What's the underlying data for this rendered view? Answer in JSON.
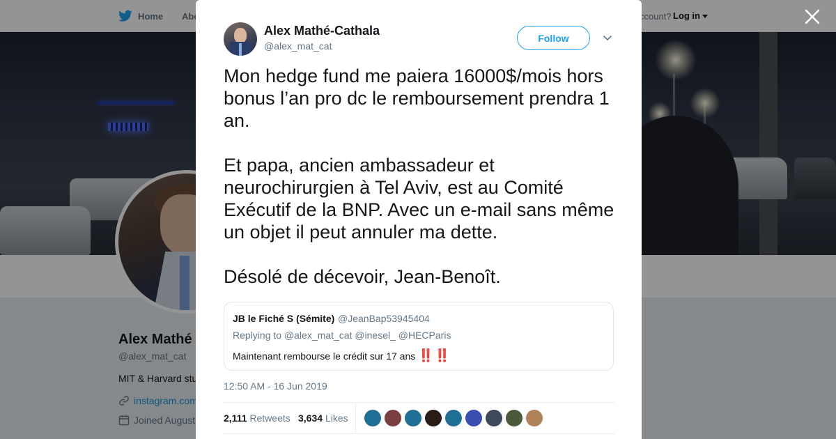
{
  "topnav": {
    "home_label": "Home",
    "about_label": "Abo",
    "account_text": "ccount?",
    "login_label": "Log in"
  },
  "profile": {
    "name": "Alex Mathé",
    "handle": "@alex_mat_cat",
    "bio": "MIT & Harvard stu",
    "link": "instagram.com",
    "joined": "Joined August"
  },
  "tweet": {
    "author_name": "Alex Mathé-Cathala",
    "author_handle": "@alex_mat_cat",
    "follow_label": "Follow",
    "text": [
      "Mon hedge fund me paiera 16000$/mois hors bonus l’an pro dc le remboursement prendra 1 an.",
      "Et papa, ancien ambassadeur et neurochirurgien à Tel Aviv, est au Comité Exécutif de la BNP. Avec un e-mail sans même un objet il peut annuler ma dette.",
      "Désolé de décevoir, Jean-Benoît."
    ],
    "quoted": {
      "name": "JB le Fiché S (Sémite)",
      "handle": "@JeanBap53945404",
      "replying_prefix": "Replying to",
      "replying_to": "@alex_mat_cat @inesel_ @HECParis",
      "text": "Maintenant rembourse le crédit sur 17 ans",
      "emoji": "‼️ ‼️"
    },
    "timestamp": "12:50 AM - 16 Jun 2019",
    "retweets_count": "2,111",
    "retweets_label": "Retweets",
    "likes_count": "3,634",
    "likes_label": "Likes"
  },
  "likers_colors": [
    "#1f6f97",
    "#7a4040",
    "#1f6f97",
    "#2a1c16",
    "#1f6f97",
    "#3a4fb0",
    "#3c4a5c",
    "#4a5a3a",
    "#b0825a"
  ],
  "colors": {
    "accent": "#1da1f2",
    "link": "#1b95e0",
    "muted": "#657786",
    "text": "#14171a"
  }
}
